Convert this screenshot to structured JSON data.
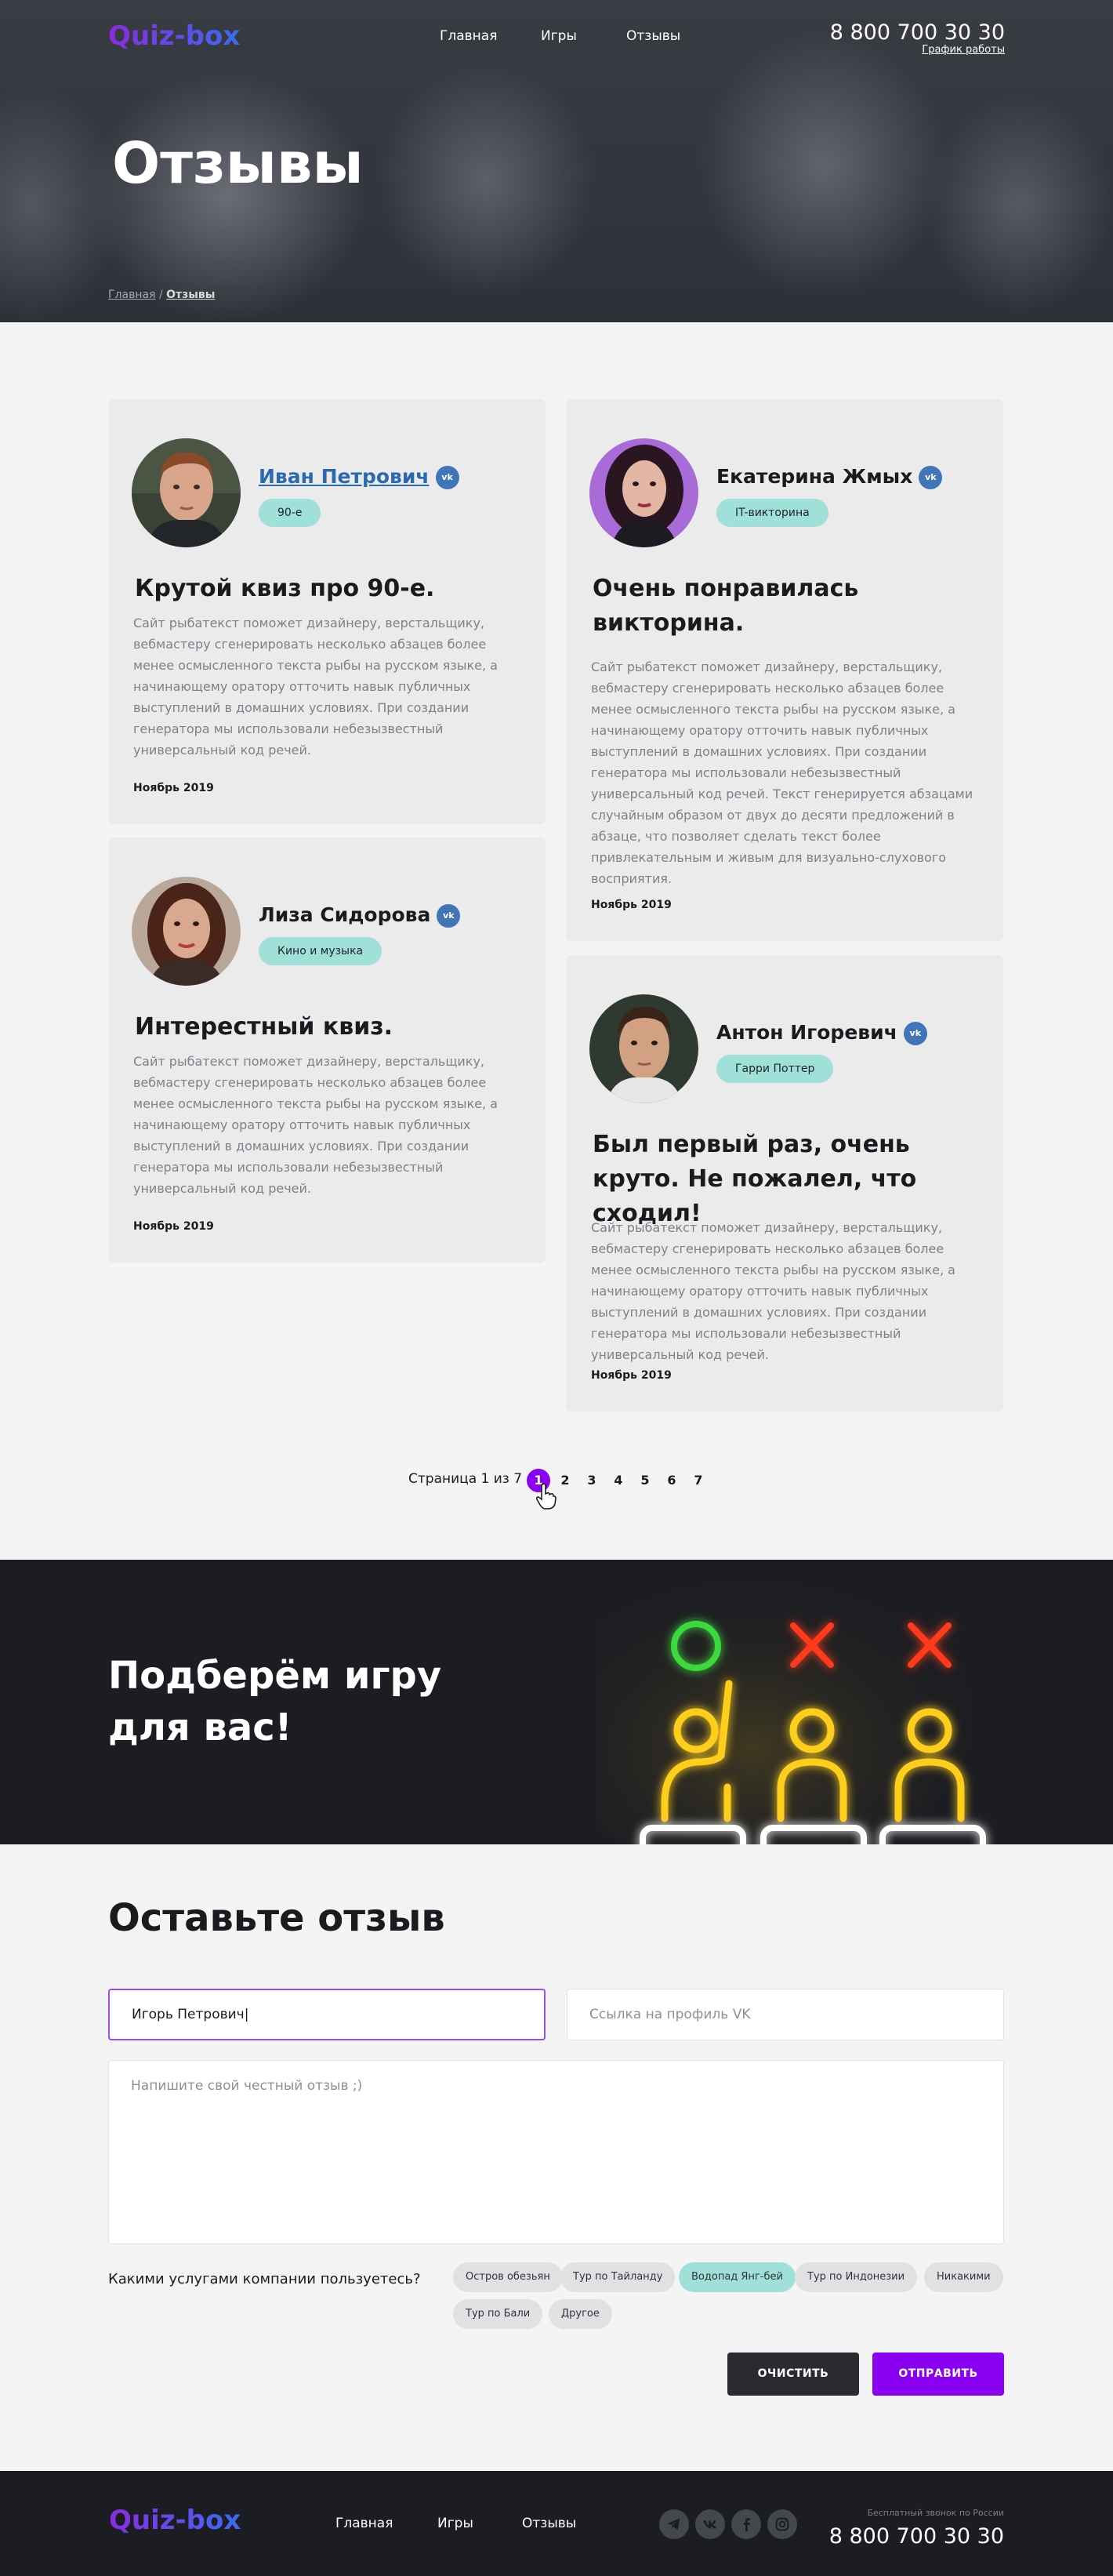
{
  "header": {
    "logo": "Quiz-box",
    "nav": [
      "Главная",
      "Игры",
      "Отзывы"
    ],
    "phone": "8 800 700 30 30",
    "schedule": "График работы"
  },
  "hero": {
    "title": "Отзывы",
    "breadcrumb": {
      "home": "Главная",
      "separator": "/",
      "current": "Отзывы"
    }
  },
  "reviews": [
    {
      "name": "Иван Петрович",
      "tag": "90-е",
      "title": "Крутой квиз про 90-е.",
      "text": "Сайт рыбатекст поможет дизайнеру, верстальщику, вебмастеру сгенерировать несколько абзацев более менее осмысленного текста рыбы на русском языке, а начинающему оратору отточить навык публичных выступлений в домашних условиях. При создании генератора мы использовали небезызвестный универсальный код речей.",
      "date": "Ноябрь 2019"
    },
    {
      "name": "Екатерина Жмых",
      "tag": "IT-викторина",
      "title": "Очень понравилась викторина.",
      "text": "Сайт рыбатекст поможет дизайнеру, верстальщику, вебмастеру сгенерировать несколько абзацев более менее осмысленного текста рыбы на русском языке, а начинающему оратору отточить навык публичных выступлений в домашних условиях. При создании генератора мы использовали небезызвестный универсальный код речей. Текст генерируется абзацами случайным образом от двух до десяти предложений в абзаце, что позволяет сделать текст более привлекательным и живым для визуально-слухового восприятия.",
      "date": "Ноябрь 2019"
    },
    {
      "name": "Лиза Сидорова",
      "tag": "Кино и музыка",
      "title": "Интерестный квиз.",
      "text": "Сайт рыбатекст поможет дизайнеру, верстальщику, вебмастеру сгенерировать несколько абзацев более менее осмысленного текста рыбы на русском языке, а начинающему оратору отточить навык публичных выступлений в домашних условиях. При создании генератора мы использовали небезызвестный универсальный код речей.",
      "date": "Ноябрь 2019"
    },
    {
      "name": "Антон Игоревич",
      "tag": "Гарри Поттер",
      "title": "Был первый раз, очень круто. Не пожалел, что сходил!",
      "text": "Сайт рыбатекст поможет дизайнеру, верстальщику, вебмастеру сгенерировать несколько абзацев более менее осмысленного текста рыбы на русском языке, а начинающему оратору отточить навык публичных выступлений в домашних условиях. При создании генератора мы использовали небезызвестный универсальный код речей.",
      "date": "Ноябрь 2019"
    }
  ],
  "vk_icon": "vk-icon",
  "pagination": {
    "label": "Страница 1 из 7",
    "pages": [
      "1",
      "2",
      "3",
      "4",
      "5",
      "6",
      "7"
    ],
    "current": 1
  },
  "banner": {
    "title": "Подберём игру для вас!",
    "title_line1": "Подберём игру",
    "title_line2": "для вас!"
  },
  "form": {
    "title": "Оставьте отзыв",
    "name_value": "Игорь Петрович|",
    "vk_placeholder": "Ссылка на профиль VK",
    "review_placeholder": "Напишите свой честный отзыв ;)",
    "services_label": "Какими услугами компании пользуетесь?",
    "services": [
      "Остров обезьян",
      "Тур по Тайланду",
      "Водопад Янг-бей",
      "Тур по Индонезии",
      "Никакими",
      "Тур по Бали",
      "Другое"
    ],
    "selected_service": "Водопад Янг-бей",
    "clear_label": "ОЧИСТИТЬ",
    "send_label": "ОТПРАВИТЬ"
  },
  "footer": {
    "logo": "Quiz-box",
    "nav": [
      "Главная",
      "Игры",
      "Отзывы"
    ],
    "social_icons": [
      "telegram-icon",
      "vk-icon",
      "facebook-icon",
      "instagram-icon"
    ],
    "free_call": "Бесплатный звонок по России",
    "phone": "8 800 700 30 30"
  },
  "colors": {
    "accent": "#8a00f0",
    "tag": "#9fe0d8",
    "dark": "#1c1d22",
    "vk": "#4076b8"
  }
}
